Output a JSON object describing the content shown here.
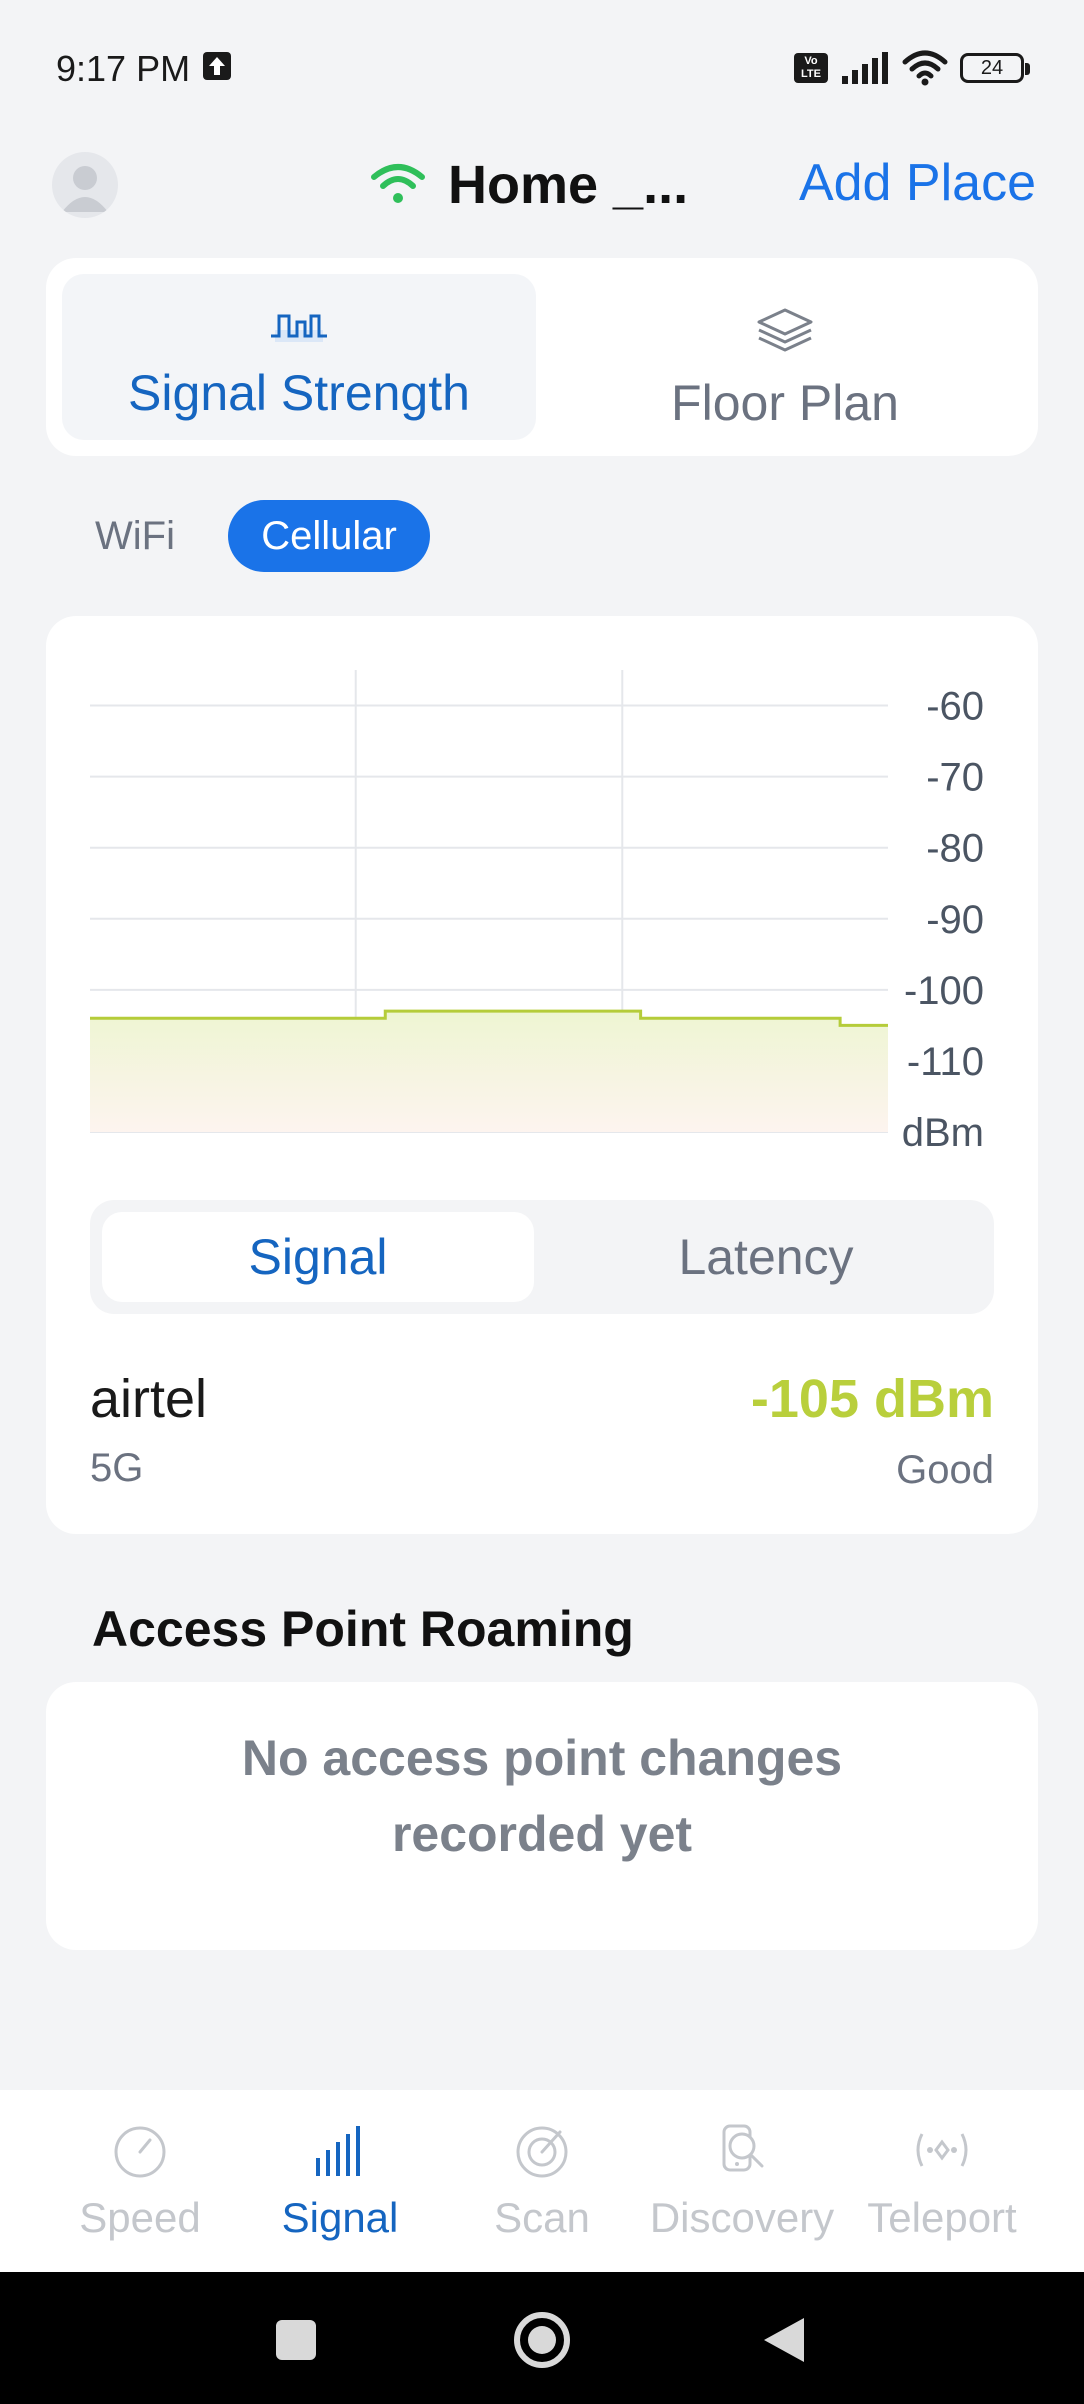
{
  "status_bar": {
    "time": "9:17 PM",
    "volte_label": "Vo\nLTE",
    "battery": "24"
  },
  "header": {
    "place_title": "Home _...",
    "add_place": "Add Place"
  },
  "mode_tabs": [
    {
      "label": "Signal Strength",
      "icon": "signal-wave-icon",
      "active": true
    },
    {
      "label": "Floor Plan",
      "icon": "layers-icon",
      "active": false
    }
  ],
  "network_pills": [
    {
      "label": "WiFi",
      "active": false
    },
    {
      "label": "Cellular",
      "active": true
    }
  ],
  "chart_data": {
    "type": "area",
    "y_ticks": [
      "-60",
      "-70",
      "-80",
      "-90",
      "-100",
      "-110"
    ],
    "y_unit": "dBm",
    "ylim": [
      -120,
      -55
    ],
    "x": [
      0,
      0.37,
      0.37,
      0.69,
      0.69,
      0.94,
      0.94,
      1.0
    ],
    "y": [
      -104,
      -104,
      -103,
      -103,
      -104,
      -104,
      -105,
      -105
    ],
    "grid": true,
    "line_color": "#b5cc3a",
    "fill_color_top": "#eef5d2",
    "fill_color_bottom": "#fdf4ef"
  },
  "chart_tabs": [
    {
      "label": "Signal",
      "active": true
    },
    {
      "label": "Latency",
      "active": false
    }
  ],
  "carrier": {
    "name": "airtel",
    "network_type": "5G",
    "signal_value": "-105 dBm",
    "quality": "Good",
    "value_color": "#b9cf3c"
  },
  "roaming": {
    "title": "Access Point Roaming",
    "empty_message": "No access point changes recorded yet"
  },
  "bottom_nav": [
    {
      "label": "Speed",
      "icon": "speedometer-icon",
      "active": false
    },
    {
      "label": "Signal",
      "icon": "signal-bars-icon",
      "active": true
    },
    {
      "label": "Scan",
      "icon": "radar-icon",
      "active": false
    },
    {
      "label": "Discovery",
      "icon": "device-search-icon",
      "active": false
    },
    {
      "label": "Teleport",
      "icon": "teleport-icon",
      "active": false
    }
  ],
  "colors": {
    "accent": "#1a73e8",
    "active_text": "#1565c0",
    "wifi_green": "#2fbf5a"
  }
}
